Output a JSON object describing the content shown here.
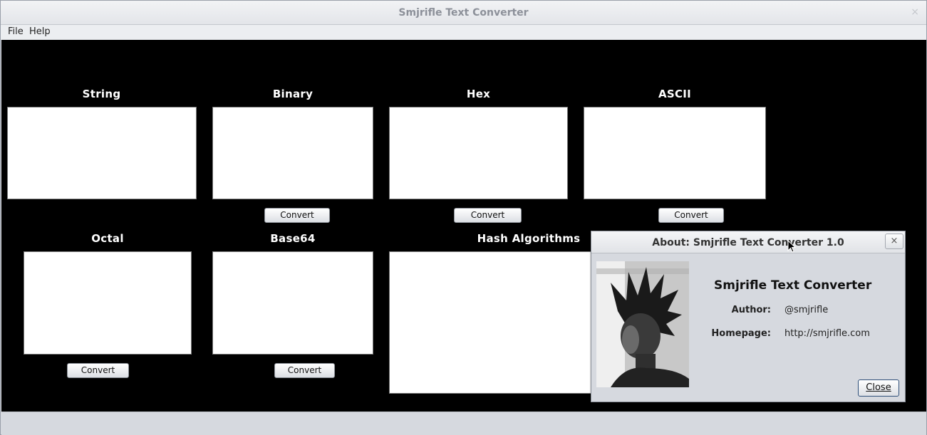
{
  "window": {
    "title": "Smjrifle Text Converter",
    "close_glyph": "×"
  },
  "menu": {
    "file": "File",
    "help": "Help"
  },
  "panels": {
    "string": {
      "label": "String"
    },
    "binary": {
      "label": "Binary",
      "button": "Convert"
    },
    "hex": {
      "label": "Hex",
      "button": "Convert"
    },
    "ascii": {
      "label": "ASCII",
      "button": "Convert"
    },
    "octal": {
      "label": "Octal",
      "button": "Convert"
    },
    "base64": {
      "label": "Base64",
      "button": "Convert"
    },
    "hash": {
      "label": "Hash Algorithms"
    }
  },
  "about": {
    "title": "About: Smjrifle Text Converter 1.0",
    "close_glyph": "×",
    "app_name": "Smjrifle Text Converter",
    "author_label": "Author:",
    "author_value": "@smjrifle",
    "homepage_label": "Homepage:",
    "homepage_value": "http://smjrifle.com",
    "close_button": "Close"
  },
  "colors": {
    "content_bg": "#000000",
    "window_bg": "#d6d9df"
  }
}
